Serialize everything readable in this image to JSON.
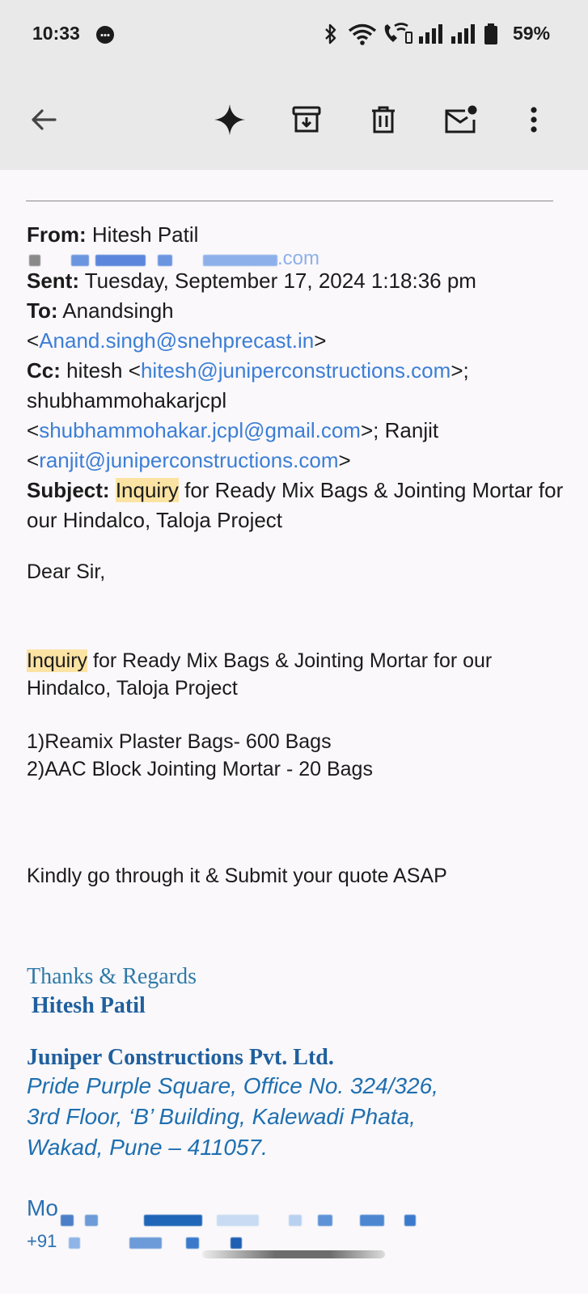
{
  "status_bar": {
    "time": "10:33",
    "battery": "59%",
    "icons": [
      "notification-dot-icon",
      "bluetooth-icon",
      "wifi-icon",
      "wifi-calling-icon",
      "signal-icon",
      "signal-icon",
      "battery-icon"
    ]
  },
  "toolbar": {
    "icons": [
      "back-arrow-icon",
      "gemini-sparkle-icon",
      "archive-icon",
      "delete-icon",
      "mark-unread-icon",
      "more-vert-icon"
    ]
  },
  "email": {
    "from_label": "From:",
    "from_name": "Hitesh Patil",
    "from_email_visible": ".com",
    "sent_label": "Sent:",
    "sent_value": "Tuesday, September 17, 2024 1:18:36 pm",
    "to_label": "To:",
    "to_name": "Anandsingh",
    "to_email": "Anand.singh@snehprecast.in",
    "cc_label": "Cc:",
    "cc_1_name": "hitesh",
    "cc_1_email": "hitesh@juniperconstructions.com",
    "cc_2_name": "shubhammohakarjcpl",
    "cc_2_email": "shubhammohakar.jcpl@gmail.com",
    "cc_3_name": "Ranjit",
    "cc_3_email": "ranjit@juniperconstructions.com",
    "subject_label": "Subject:",
    "subject_highlight": "Inquiry",
    "subject_rest": "for Ready Mix Bags & Jointing Mortar for our Hindalco, Taloja Project"
  },
  "body": {
    "greeting": "Dear Sir,",
    "intro_highlight": "Inquiry",
    "intro_rest": "for Ready Mix Bags & Jointing Mortar for our Hindalco, Taloja Project",
    "item_1": "1)Reamix Plaster Bags- 600 Bags",
    "item_2": "2)AAC Block Jointing Mortar - 20 Bags",
    "request": "Kindly go through it & Submit your quote ASAP"
  },
  "signature": {
    "thanks": "Thanks & Regards",
    "name": "Hitesh Patil",
    "company": "Juniper Constructions Pvt. Ltd.",
    "address_1": "Pride Purple Square, Office No. 324/326,",
    "address_2": "3rd Floor, ‘B’ Building, Kalewadi Phata,",
    "address_3": "Wakad, Pune – 411057.",
    "mobile_label": "Mo",
    "phone_prefix": "+91"
  }
}
